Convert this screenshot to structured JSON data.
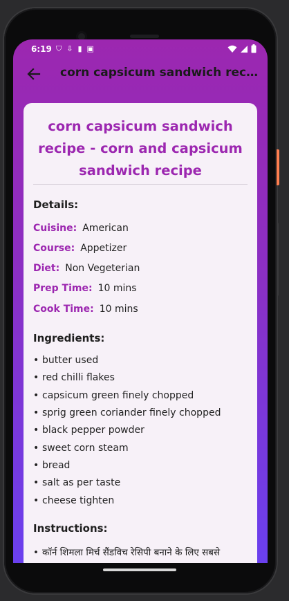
{
  "status": {
    "time": "6:19"
  },
  "appbar": {
    "title": "corn capsicum sandwich recipe - corn and capsicum sandwich recipe"
  },
  "recipe": {
    "title": "corn capsicum sandwich recipe - corn and capsicum sandwich recipe",
    "details_heading": "Details:",
    "details": [
      {
        "key": "Cuisine:",
        "value": "American"
      },
      {
        "key": "Course:",
        "value": "Appetizer"
      },
      {
        "key": "Diet:",
        "value": "Non Vegeterian"
      },
      {
        "key": "Prep Time:",
        "value": "10 mins"
      },
      {
        "key": "Cook Time:",
        "value": "10 mins"
      }
    ],
    "ingredients_heading": "Ingredients:",
    "ingredients": [
      "butter used",
      "red chilli flakes",
      "capsicum green finely chopped",
      "sprig green coriander finely chopped",
      "black pepper powder",
      "sweet corn steam",
      "bread",
      "salt as per taste",
      "cheese tighten"
    ],
    "instructions_heading": "Instructions:",
    "instructions": [
      "कॉर्न शिमला मिर्च सैंडविच रेसिपी बनाने के लिए सबसे"
    ]
  },
  "colors": {
    "accent": "#9c27b0",
    "gradient_end": "#6a40ef",
    "card": "#f7f1f8"
  },
  "icons": {
    "back": "arrow-back-icon",
    "wifi": "wifi-icon",
    "signal": "signal-icon",
    "battery": "battery-icon"
  }
}
